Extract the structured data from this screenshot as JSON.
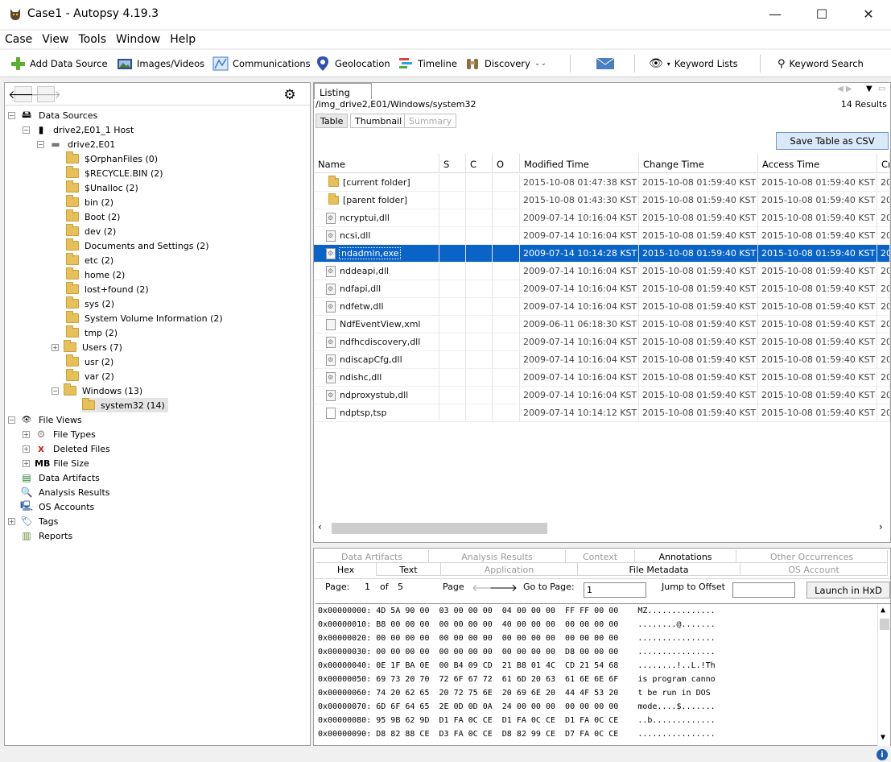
{
  "window": {
    "title": "Case1 - Autopsy 4.19.3",
    "minimize": "—",
    "maximize": "☐",
    "close": "✕"
  },
  "menu": [
    "Case",
    "View",
    "Tools",
    "Window",
    "Help"
  ],
  "toolbar": {
    "add_data_source": "Add Data Source",
    "images_videos": "Images/Videos",
    "communications": "Communications",
    "geolocation": "Geolocation",
    "timeline": "Timeline",
    "discovery": "Discovery",
    "keyword_lists": "Keyword Lists",
    "keyword_search": "Keyword Search"
  },
  "tree": {
    "data_sources": "Data Sources",
    "host": "drive2,E01_1 Host",
    "image": "drive2,E01",
    "folders": [
      "$OrphanFiles (0)",
      "$RECYCLE.BIN (2)",
      "$Unalloc (2)",
      "bin (2)",
      "Boot (2)",
      "dev (2)",
      "Documents and Settings (2)",
      "etc (2)",
      "home (2)",
      "lost+found (2)",
      "sys (2)",
      "System Volume Information (2)",
      "tmp (2)",
      "Users (7)",
      "usr (2)",
      "var (2)",
      "Windows (13)"
    ],
    "selected_folder": "system32 (14)",
    "file_views": "File Views",
    "file_types": "File Types",
    "deleted_files": "Deleted Files",
    "file_size": "File Size",
    "file_size_icon": "MB",
    "data_artifacts": "Data Artifacts",
    "analysis_results": "Analysis Results",
    "os_accounts": "OS Accounts",
    "tags": "Tags",
    "reports": "Reports"
  },
  "listing": {
    "tab": "Listing",
    "path": "/img_drive2,E01/Windows/system32",
    "result_count": "14  Results",
    "subtabs": [
      "Table",
      "Thumbnail",
      "Summary"
    ],
    "save_csv": "Save Table as CSV",
    "columns": [
      "Name",
      "S",
      "C",
      "O",
      "Modified Time",
      "Change Time",
      "Access Time",
      "Cr"
    ],
    "rows": [
      {
        "name": "[current folder]",
        "icon": "folder",
        "modified": "2015-10-08 01:47:38 KST",
        "change": "2015-10-08 01:59:40 KST",
        "access": "2015-10-08 01:59:40 KST",
        "cr": "20"
      },
      {
        "name": "[parent folder]",
        "icon": "folder",
        "modified": "2015-10-08 01:43:30 KST",
        "change": "2015-10-08 01:59:40 KST",
        "access": "2015-10-08 01:59:40 KST",
        "cr": "20"
      },
      {
        "name": "ncryptui,dll",
        "icon": "gear-file",
        "modified": "2009-07-14 10:16:04 KST",
        "change": "2015-10-08 01:59:40 KST",
        "access": "2015-10-08 01:59:40 KST",
        "cr": "20"
      },
      {
        "name": "ncsi,dll",
        "icon": "gear-file",
        "modified": "2009-07-14 10:16:04 KST",
        "change": "2015-10-08 01:59:40 KST",
        "access": "2015-10-08 01:59:40 KST",
        "cr": "20"
      },
      {
        "name": "ndadmin,exe",
        "icon": "gear-file",
        "modified": "2009-07-14 10:14:28 KST",
        "change": "2015-10-08 01:59:40 KST",
        "access": "2015-10-08 01:59:40 KST",
        "cr": "20",
        "selected": true
      },
      {
        "name": "nddeapi,dll",
        "icon": "gear-file",
        "modified": "2009-07-14 10:16:04 KST",
        "change": "2015-10-08 01:59:40 KST",
        "access": "2015-10-08 01:59:40 KST",
        "cr": "20"
      },
      {
        "name": "ndfapi,dll",
        "icon": "gear-file",
        "modified": "2009-07-14 10:16:04 KST",
        "change": "2015-10-08 01:59:40 KST",
        "access": "2015-10-08 01:59:40 KST",
        "cr": "20"
      },
      {
        "name": "ndfetw,dll",
        "icon": "gear-file",
        "modified": "2009-07-14 10:16:04 KST",
        "change": "2015-10-08 01:59:40 KST",
        "access": "2015-10-08 01:59:40 KST",
        "cr": "20"
      },
      {
        "name": "NdfEventView,xml",
        "icon": "text-file",
        "modified": "2009-06-11 06:18:30 KST",
        "change": "2015-10-08 01:59:40 KST",
        "access": "2015-10-08 01:59:40 KST",
        "cr": "20"
      },
      {
        "name": "ndfhcdiscovery,dll",
        "icon": "gear-file",
        "modified": "2009-07-14 10:16:04 KST",
        "change": "2015-10-08 01:59:40 KST",
        "access": "2015-10-08 01:59:40 KST",
        "cr": "20"
      },
      {
        "name": "ndiscapCfg,dll",
        "icon": "gear-file",
        "modified": "2009-07-14 10:16:04 KST",
        "change": "2015-10-08 01:59:40 KST",
        "access": "2015-10-08 01:59:40 KST",
        "cr": "20"
      },
      {
        "name": "ndishc,dll",
        "icon": "gear-file",
        "modified": "2009-07-14 10:16:04 KST",
        "change": "2015-10-08 01:59:40 KST",
        "access": "2015-10-08 01:59:40 KST",
        "cr": "20"
      },
      {
        "name": "ndproxystub,dll",
        "icon": "gear-file",
        "modified": "2009-07-14 10:16:04 KST",
        "change": "2015-10-08 01:59:40 KST",
        "access": "2015-10-08 01:59:40 KST",
        "cr": "20"
      },
      {
        "name": "ndptsp,tsp",
        "icon": "blank-file",
        "modified": "2009-07-14 10:14:12 KST",
        "change": "2015-10-08 01:59:40 KST",
        "access": "2015-10-08 01:59:40 KST",
        "cr": "20"
      }
    ]
  },
  "content_viewer": {
    "tabs_row1": [
      "Data Artifacts",
      "Analysis Results",
      "Context",
      "Annotations",
      "Other Occurrences"
    ],
    "tabs_row2": [
      "Hex",
      "Text",
      "Application",
      "File Metadata",
      "OS Account"
    ],
    "page_label": "Page:",
    "page_current": "1",
    "page_of": "of",
    "page_total": "5",
    "page_nav_label": "Page",
    "goto_label": "Go to Page:",
    "goto_value": "1",
    "jump_label": "Jump to Offset",
    "launch_hxd": "Launch in HxD",
    "hex_lines": [
      "0x00000000: 4D 5A 90 00  03 00 00 00  04 00 00 00  FF FF 00 00    MZ..............",
      "0x00000010: B8 00 00 00  00 00 00 00  40 00 00 00  00 00 00 00    ........@.......",
      "0x00000020: 00 00 00 00  00 00 00 00  00 00 00 00  00 00 00 00    ................",
      "0x00000030: 00 00 00 00  00 00 00 00  00 00 00 00  D8 00 00 00    ................",
      "0x00000040: 0E 1F BA 0E  00 B4 09 CD  21 B8 01 4C  CD 21 54 68    ........!..L.!Th",
      "0x00000050: 69 73 20 70  72 6F 67 72  61 6D 20 63  61 6E 6E 6F    is program canno",
      "0x00000060: 74 20 62 65  20 72 75 6E  20 69 6E 20  44 4F 53 20    t be run in DOS ",
      "0x00000070: 6D 6F 64 65  2E 0D 0D 0A  24 00 00 00  00 00 00 00    mode....$.......",
      "0x00000080: 95 9B 62 9D  D1 FA 0C CE  D1 FA 0C CE  D1 FA 0C CE    ..b.............",
      "0x00000090: D8 82 88 CE  D3 FA 0C CE  D8 82 99 CE  D7 FA 0C CE    ................"
    ]
  }
}
